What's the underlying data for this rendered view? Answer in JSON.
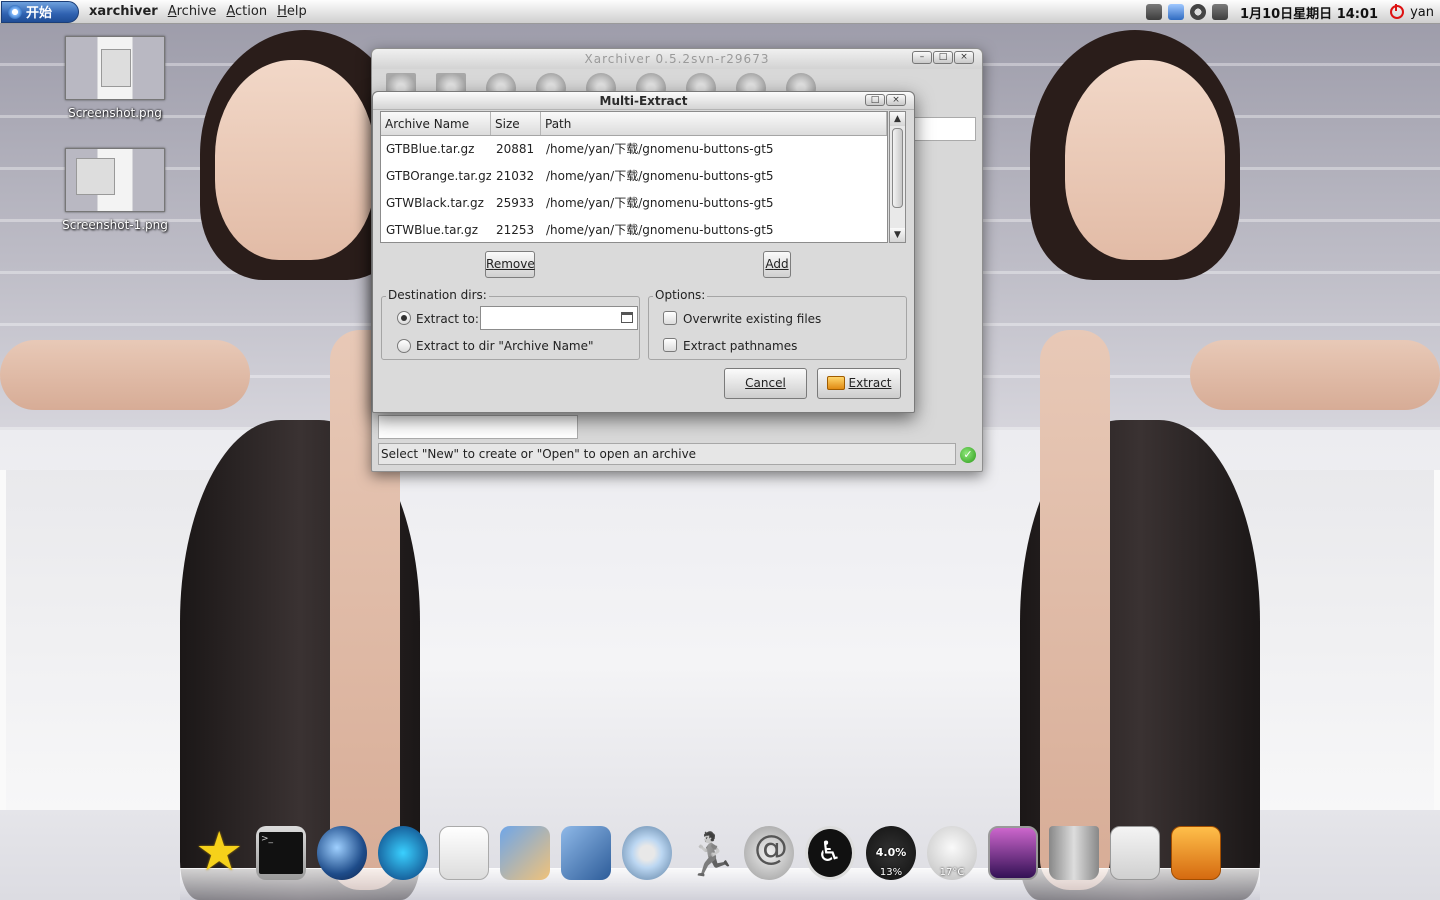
{
  "top_panel": {
    "start_label": "开始",
    "app_name": "xarchiver",
    "menu": [
      {
        "label": "Archive",
        "mnemonic": "A"
      },
      {
        "label": "Action",
        "mnemonic": "A"
      },
      {
        "label": "Help",
        "mnemonic": "H"
      }
    ],
    "clock": "1月10日星期日 14:01",
    "user": "yan"
  },
  "desktop_icons": [
    {
      "label": "Screenshot.png"
    },
    {
      "label": "Screenshot-1.png"
    }
  ],
  "xarchiver_window": {
    "title": "Xarchiver 0.5.2svn-r29673",
    "status_text": "Select \"New\" to create or \"Open\" to open an archive"
  },
  "multi_extract": {
    "title": "Multi-Extract",
    "columns": [
      "Archive Name",
      "Size",
      "Path"
    ],
    "rows": [
      {
        "name": "GTBBlue.tar.gz",
        "size": "20881",
        "path": "/home/yan/下载/gnomenu-buttons-gt5"
      },
      {
        "name": "GTBOrange.tar.gz",
        "size": "21032",
        "path": "/home/yan/下载/gnomenu-buttons-gt5"
      },
      {
        "name": "GTWBlack.tar.gz",
        "size": "25933",
        "path": "/home/yan/下载/gnomenu-buttons-gt5"
      },
      {
        "name": "GTWBlue.tar.gz",
        "size": "21253",
        "path": "/home/yan/下载/gnomenu-buttons-gt5"
      }
    ],
    "remove_label": "Remove",
    "add_label": "Add",
    "destination_legend": "Destination dirs:",
    "extract_to_label": "Extract to:",
    "extract_to_value": "",
    "extract_to_dir_label": "Extract to dir \"Archive Name\"",
    "options_legend": "Options:",
    "overwrite_label": "Overwrite existing files",
    "pathnames_label": "Extract pathnames",
    "cancel_label": "Cancel",
    "extract_label": "Extract"
  },
  "dock": {
    "gauge_value": "4.0%",
    "gauge_sub": "13%",
    "weather_temp": "17°C"
  }
}
